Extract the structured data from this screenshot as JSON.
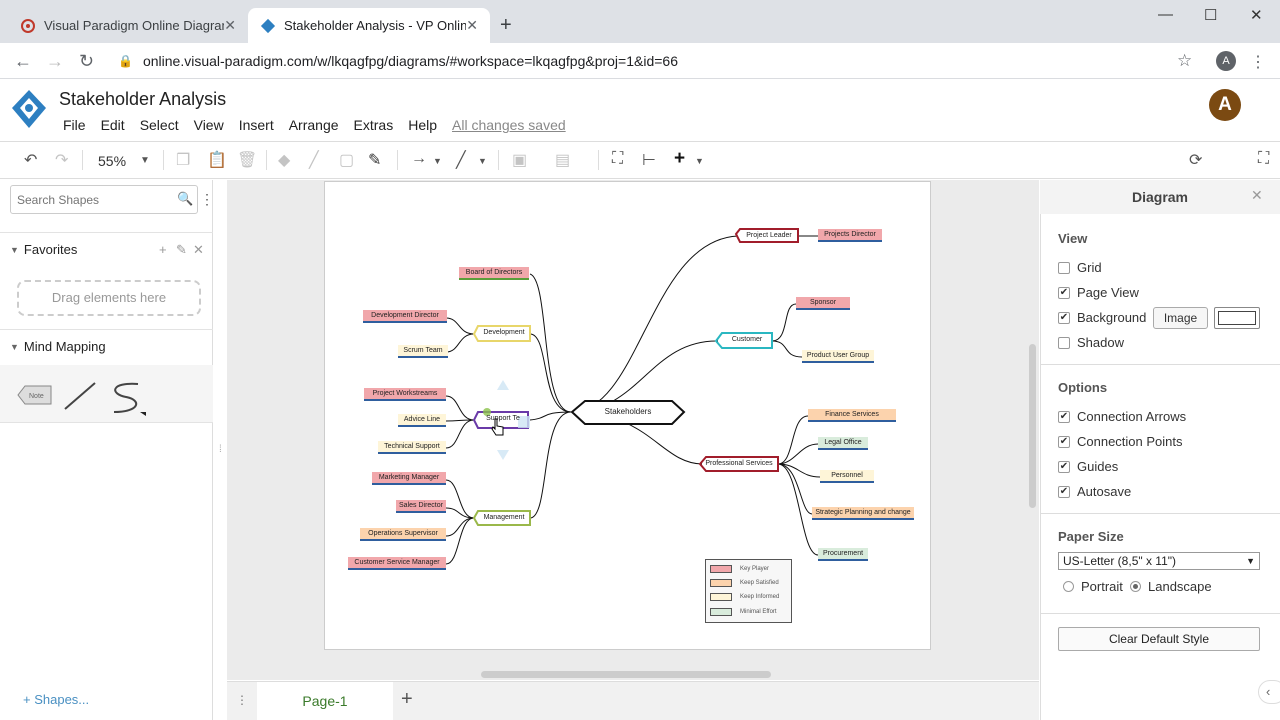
{
  "browser": {
    "tabs": [
      {
        "title": "Visual Paradigm Online Diagrams",
        "active": false
      },
      {
        "title": "Stakeholder Analysis - VP Online",
        "active": true
      }
    ],
    "url": "online.visual-paradigm.com/w/lkqagfpg/diagrams/#workspace=lkqagfpg&proj=1&id=66",
    "profile_letter": "A"
  },
  "app": {
    "title": "Stakeholder Analysis",
    "menu": [
      "File",
      "Edit",
      "Select",
      "View",
      "Insert",
      "Arrange",
      "Extras",
      "Help"
    ],
    "save_status": "All changes saved",
    "avatar_letter": "A",
    "accent_color": "#2d7fc1"
  },
  "toolbar": {
    "zoom": "55%"
  },
  "left_panel": {
    "search_placeholder": "Search Shapes",
    "favorites_label": "Favorites",
    "drop_hint": "Drag elements here",
    "mindmap_label": "Mind Mapping",
    "shapes_link": "+ Shapes...",
    "note_shape_label": "Note"
  },
  "diagram": {
    "central": "Stakeholders",
    "branches": {
      "project_leader": "Project Leader",
      "customer": "Customer",
      "professional_services": "Professional Services",
      "development": "Development",
      "support_team": "Support Te",
      "management": "Management"
    },
    "leaves": {
      "projects_director": "Projects Director",
      "sponsor": "Sponsor",
      "product_user_group": "Product User Group",
      "finance_services": "Finance Services",
      "legal_office": "Legal Office",
      "personnel": "Personnel",
      "strategic_planning": "Strategic Planning and change",
      "procurement": "Procurement",
      "board_of_directors": "Board of Directors",
      "development_director": "Development Director",
      "scrum_team": "Scrum Team",
      "project_workstreams": "Project Workstreams",
      "advice_line": "Advice Line",
      "technical_support": "Technical Support",
      "marketing_manager": "Marketing Manager",
      "sales_director": "Sales Director",
      "operations_supervisor": "Operations Supervisor",
      "customer_service_manager": "Customer Service Manager"
    },
    "legend": [
      "Key Player",
      "Keep Satisfied",
      "Keep Informed",
      "Minimal Effort"
    ],
    "colors": {
      "key_player": "#f1a7ab",
      "keep_satisfied": "#fcd3ad",
      "keep_informed": "#fef5d8",
      "minimal_effort": "#d9ecdc"
    }
  },
  "page_tabs": {
    "current": "Page-1"
  },
  "right_panel": {
    "title": "Diagram",
    "view_heading": "View",
    "view_options": [
      {
        "label": "Grid",
        "checked": false
      },
      {
        "label": "Page View",
        "checked": true
      },
      {
        "label": "Background",
        "checked": true
      },
      {
        "label": "Shadow",
        "checked": false
      }
    ],
    "image_button": "Image",
    "options_heading": "Options",
    "options": [
      {
        "label": "Connection Arrows",
        "checked": true
      },
      {
        "label": "Connection Points",
        "checked": true
      },
      {
        "label": "Guides",
        "checked": true
      },
      {
        "label": "Autosave",
        "checked": true
      }
    ],
    "paper_size_heading": "Paper Size",
    "paper_size_value": "US-Letter (8,5\" x 11\")",
    "orientation": {
      "portrait": "Portrait",
      "landscape": "Landscape",
      "selected": "landscape"
    },
    "clear_button": "Clear Default Style"
  }
}
